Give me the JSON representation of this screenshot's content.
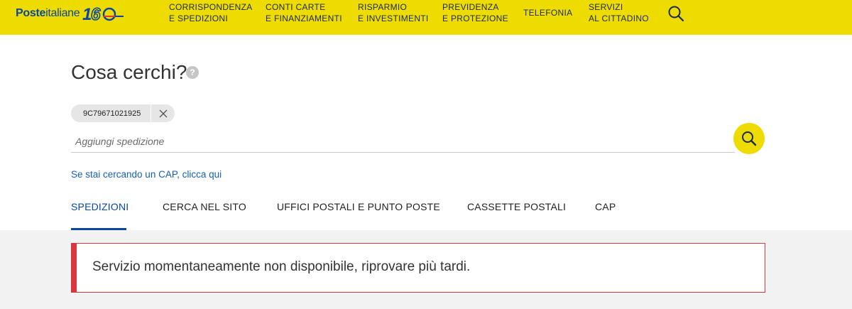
{
  "header": {
    "brand_bold": "Poste",
    "brand_light": "italiane",
    "nav": [
      {
        "line1": "CORRISPONDENZA",
        "line2": "E SPEDIZIONI"
      },
      {
        "line1": "CONTI CARTE",
        "line2": "E FINANZIAMENTI"
      },
      {
        "line1": "RISPARMIO",
        "line2": "E INVESTIMENTI"
      },
      {
        "line1": "PREVIDENZA",
        "line2": "E PROTEZIONE"
      },
      {
        "line1": "TELEFONIA",
        "line2": ""
      },
      {
        "line1": "SERVIZI",
        "line2": "AL CITTADINO"
      }
    ]
  },
  "search": {
    "title": "Cosa cerchi?",
    "help": "?",
    "chip": "9C79671021925",
    "placeholder": "Aggiungi spedizione",
    "cap_link": "Se stai cercando un CAP, clicca qui"
  },
  "tabs": [
    {
      "label": "SPEDIZIONI",
      "active": true
    },
    {
      "label": "CERCA NEL SITO"
    },
    {
      "label": "UFFICI POSTALI E PUNTO POSTE"
    },
    {
      "label": "CASSETTE POSTALI"
    },
    {
      "label": "CAP"
    }
  ],
  "alert": {
    "message": "Servizio momentaneamente non disponibile, riprovare più tardi."
  },
  "colors": {
    "brand_yellow": "#eedc00",
    "brand_blue": "#0a47a0",
    "error_red": "#d9363e"
  }
}
